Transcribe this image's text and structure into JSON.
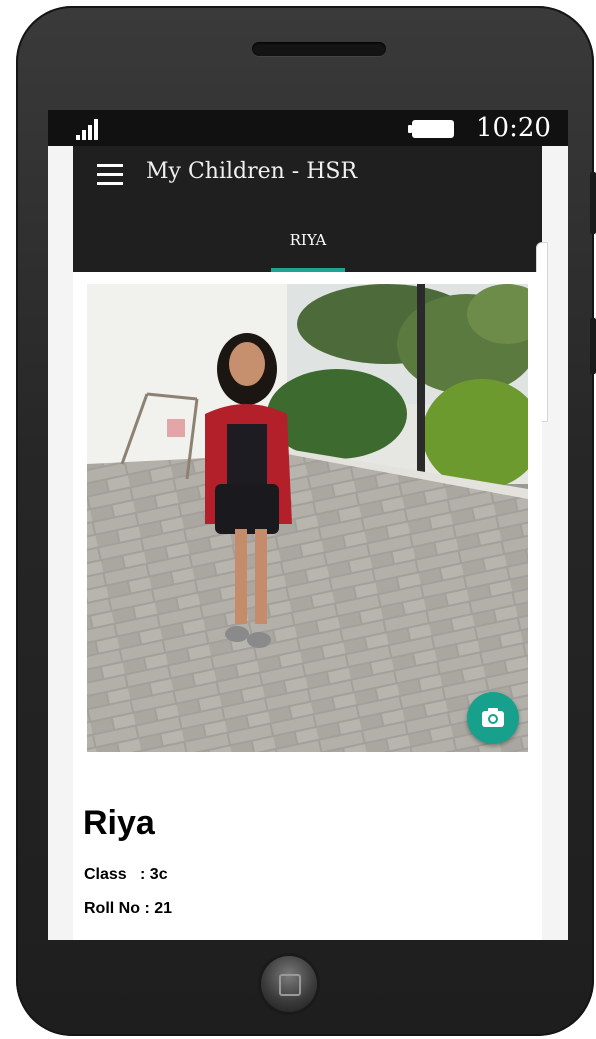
{
  "status_bar": {
    "time": "10:20"
  },
  "app_bar": {
    "title": "My Children - HSR"
  },
  "tabs": [
    {
      "label": "RIYA",
      "selected": true
    }
  ],
  "child": {
    "name": "Riya",
    "class_line": "Class   : 3c",
    "roll_line": "Roll No : 21"
  },
  "icons": {
    "menu": "hamburger-menu-icon",
    "camera": "camera-icon",
    "signal": "signal-icon",
    "battery": "battery-icon"
  },
  "colors": {
    "app_bar": "#1f1f1f",
    "accent": "#21a393",
    "fab": "#17a08c"
  }
}
